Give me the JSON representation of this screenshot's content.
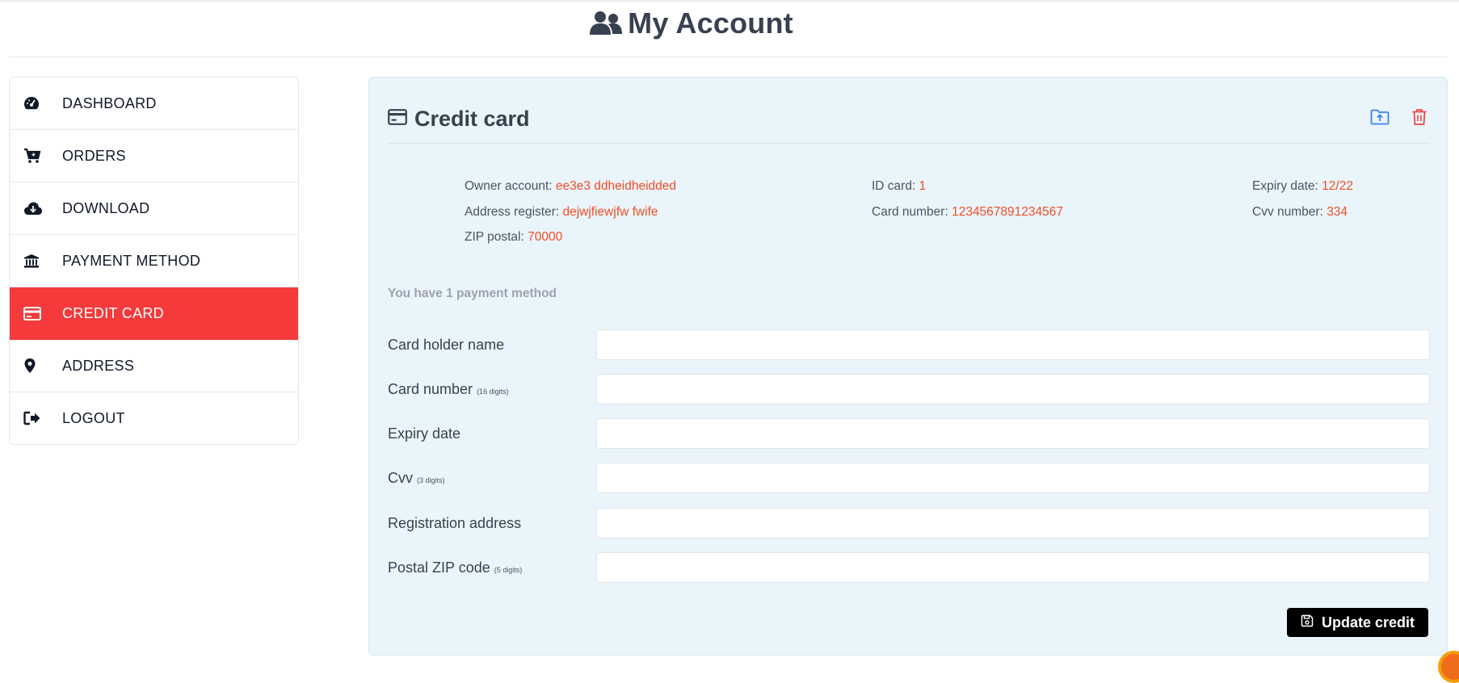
{
  "header": {
    "title": "My Account",
    "icon": "users-icon"
  },
  "sidebar": {
    "items": [
      {
        "label": "DASHBOARD",
        "icon": "gauge-icon",
        "active": false
      },
      {
        "label": "ORDERS",
        "icon": "cart-icon",
        "active": false
      },
      {
        "label": "DOWNLOAD",
        "icon": "cloud-download-icon",
        "active": false
      },
      {
        "label": "PAYMENT METHOD",
        "icon": "bank-icon",
        "active": false
      },
      {
        "label": "CREDIT CARD",
        "icon": "credit-card-icon",
        "active": true
      },
      {
        "label": "ADDRESS",
        "icon": "map-pin-icon",
        "active": false
      },
      {
        "label": "LOGOUT",
        "icon": "logout-icon",
        "active": false
      }
    ]
  },
  "panel": {
    "title": "Credit card",
    "info": {
      "owner_label": "Owner account:",
      "owner_value": "ee3e3 ddheidheidded",
      "address_label": "Address register:",
      "address_value": "dejwjfiewjfw fwife",
      "zip_label": "ZIP postal:",
      "zip_value": "70000",
      "idcard_label": "ID card:",
      "idcard_value": "1",
      "cardnum_label": "Card number:",
      "cardnum_value": "1234567891234567",
      "expiry_label": "Expiry date:",
      "expiry_value": "12/22",
      "cvv_label": "Cvv number:",
      "cvv_value": "334"
    },
    "count_note": "You have 1 payment method",
    "form": {
      "holder_label": "Card holder name",
      "cardnum_label": "Card number",
      "cardnum_hint": "(16 digits)",
      "expiry_label": "Expiry date",
      "cvv_label": "Cvv",
      "cvv_hint": "(3 digits)",
      "regaddr_label": "Registration address",
      "zip_label": "Postal ZIP code",
      "zip_hint": "(5 digits)"
    },
    "update_label": "Update credit"
  },
  "colors": {
    "accent": "#f43a3a",
    "value_text": "#f04e23",
    "panel_bg": "#eaf4fb",
    "button_bg": "#000000",
    "action_blue": "#3b82f6",
    "action_red": "#ef4444"
  }
}
